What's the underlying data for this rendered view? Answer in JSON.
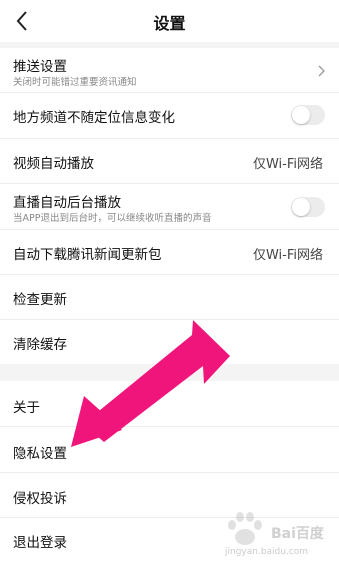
{
  "header": {
    "title": "设置"
  },
  "settings": {
    "push": {
      "label": "推送设置",
      "sub": "关闭时可能错过重要资讯通知"
    },
    "local_channel": {
      "label": "地方频道不随定位信息变化"
    },
    "video_autoplay": {
      "label": "视频自动播放",
      "value": "仅Wi-Fi网络"
    },
    "live_background": {
      "label": "直播自动后台播放",
      "sub": "当APP退出到后台时，可以继续收听直播的声音"
    },
    "auto_download": {
      "label": "自动下载腾讯新闻更新包",
      "value": "仅Wi-Fi网络"
    },
    "check_update": {
      "label": "检查更新"
    },
    "clear_cache": {
      "label": "清除缓存"
    }
  },
  "more": {
    "about": {
      "label": "关于"
    },
    "privacy": {
      "label": "隐私设置"
    },
    "complaint": {
      "label": "侵权投诉"
    },
    "logout": {
      "label": "退出登录"
    }
  },
  "watermark": {
    "brand": "Bai百度",
    "url": "jingyan.baidu.com"
  },
  "colors": {
    "arrow": "#f0157a",
    "toggle_off": "#ececec"
  }
}
